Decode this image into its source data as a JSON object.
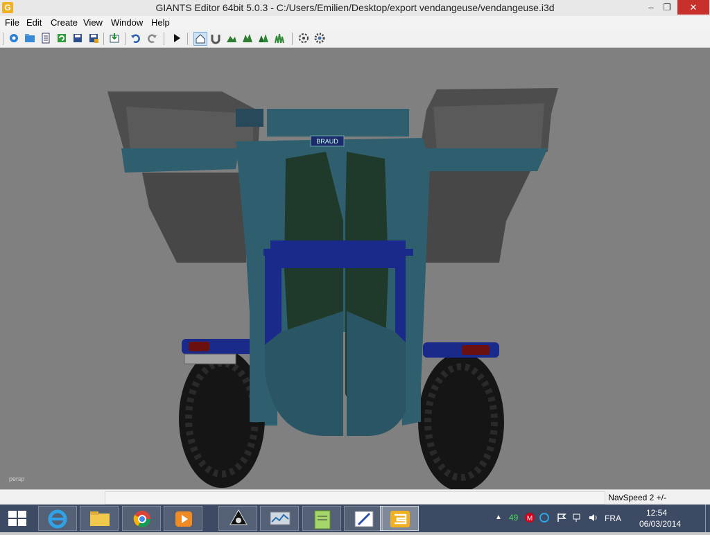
{
  "window": {
    "title": "GIANTS Editor 64bit 5.0.3 - C:/Users/Emilien/Desktop/export vendangeuse/vendangeuse.i3d",
    "app_icon_glyph": "G",
    "controls": {
      "minimize": "–",
      "restore": "❐",
      "close": "✕"
    }
  },
  "menu": {
    "items": [
      {
        "label": "File"
      },
      {
        "label": "Edit"
      },
      {
        "label": "Create"
      },
      {
        "label": "View"
      },
      {
        "label": "Window"
      },
      {
        "label": "Help"
      }
    ]
  },
  "toolbar": {
    "icons": [
      "new-icon",
      "open-icon",
      "scenegraph-icon",
      "refresh-icon",
      "save-icon",
      "save-as-icon",
      "import-icon",
      "undo-icon",
      "redo-icon",
      "play-icon",
      "camera-home-icon",
      "magnet-icon",
      "terrain-paint-icon",
      "foliage-paint-icon",
      "tree-paint-icon",
      "grass-paint-icon",
      "script-icon",
      "settings-icon"
    ]
  },
  "viewport": {
    "camera_label": "persp",
    "colors": {
      "background": "#808080",
      "body": "#2f5f6e",
      "tire": "#151515",
      "panel": "#4a4a4a",
      "frame_blue": "#1a2a8a"
    },
    "plate_text": "BRAUD"
  },
  "statusbar": {
    "navspeed": "NavSpeed 2 +/-"
  },
  "taskbar": {
    "apps": [
      {
        "name": "internet-explorer",
        "active": false
      },
      {
        "name": "file-explorer",
        "active": false
      },
      {
        "name": "chrome",
        "active": false
      },
      {
        "name": "media-player",
        "active": false
      },
      {
        "name": "inkscape",
        "active": false
      },
      {
        "name": "performance-monitor",
        "active": false
      },
      {
        "name": "notepad-plus-plus",
        "active": false
      },
      {
        "name": "paint",
        "active": false
      },
      {
        "name": "giants-editor",
        "active": true
      }
    ],
    "tray": {
      "chevron": "▲",
      "badge_count": "49",
      "language": "FRA",
      "time": "12:54",
      "date": "06/03/2014"
    }
  }
}
